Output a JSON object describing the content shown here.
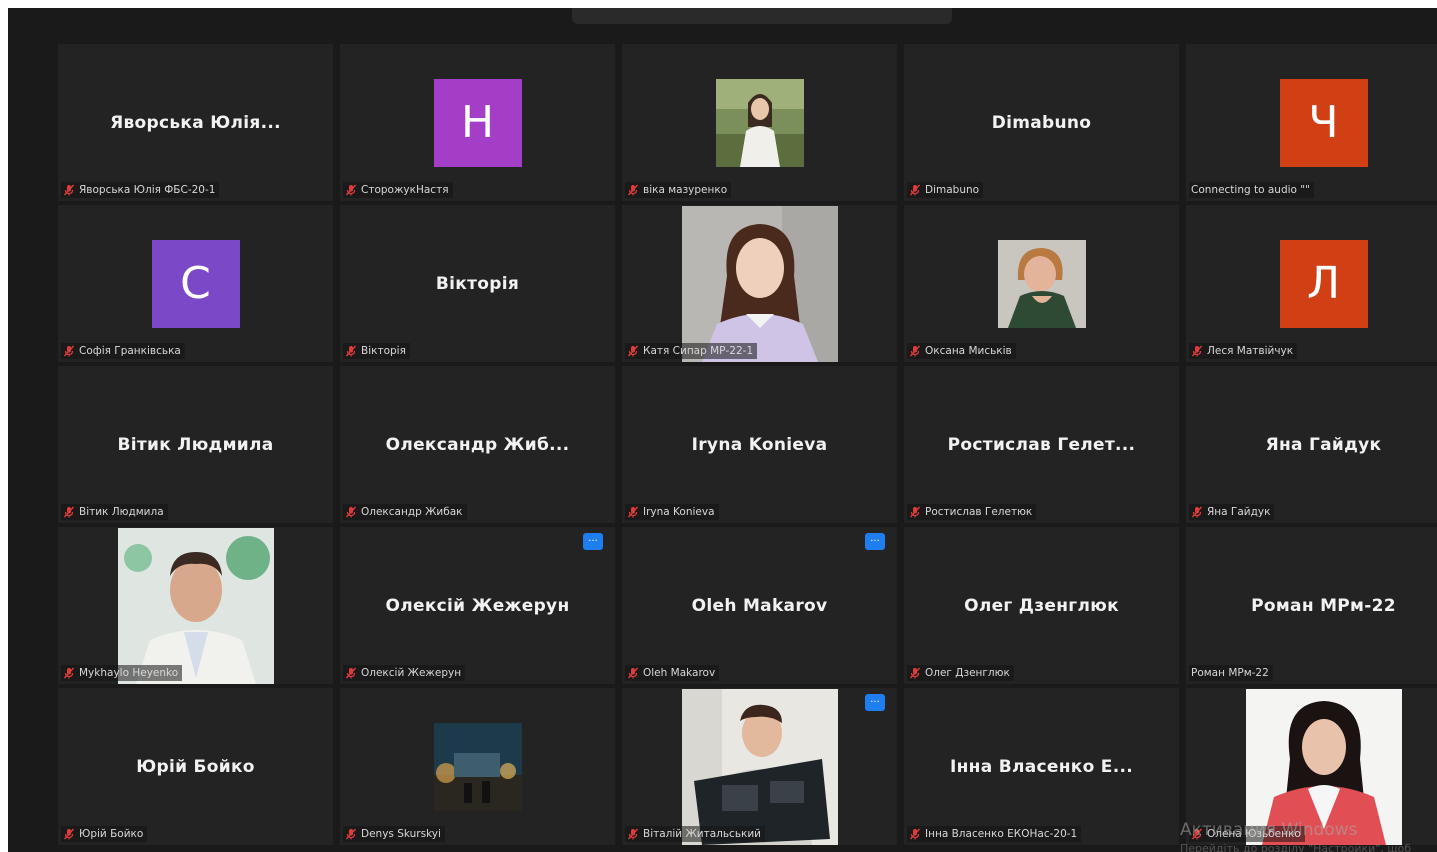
{
  "colors": {
    "background": "#1a1a1a",
    "tile": "#232323",
    "mic_muted": "#e03b3b",
    "more_button": "#1e7ef0"
  },
  "tiles": [
    {
      "display": "Яворська Юлія...",
      "label": "Яворська Юлія ФБС-20-1"
    },
    {
      "avatar": "Н",
      "avatar_color": "#a43ec7",
      "label": "СторожукНастя"
    },
    {
      "photo": "woman-in-field-photo",
      "label": "віка мазуренко"
    },
    {
      "display": "Dimabuno",
      "label": "Dimabuno"
    },
    {
      "avatar": "Ч",
      "avatar_color": "#d04014",
      "label": "Connecting to audio \"\""
    },
    {
      "avatar": "С",
      "avatar_color": "#7b48c8",
      "label": "Софія Гранківська"
    },
    {
      "display": "Вікторія",
      "label": "Вікторія"
    },
    {
      "photo": "young-woman-portrait-photo",
      "label": "Катя Сипар  МР-22-1"
    },
    {
      "photo": "woman-green-dress-photo",
      "label": "Оксана Миськів"
    },
    {
      "avatar": "Л",
      "avatar_color": "#d04014",
      "label": "Леся Матвійчук"
    },
    {
      "display": "Вітик Людмила",
      "label": "Вітик Людмила"
    },
    {
      "display": "Олександр Жиб...",
      "label": "Олександр Жибак"
    },
    {
      "display": "Iryna Konieva",
      "label": "Iryna Konieva"
    },
    {
      "display": "Ростислав Гелет...",
      "label": "Ростислав Гелетюк"
    },
    {
      "display": "Яна Гайдук",
      "label": "Яна Гайдук"
    },
    {
      "photo": "man-portrait-photo",
      "label": "Mykhaylo Heyenko"
    },
    {
      "display": "Олексій Жежерун",
      "label": "Олексій Жежерун",
      "more": "..."
    },
    {
      "display": "Oleh Makarov",
      "label": "Oleh Makarov",
      "more": "..."
    },
    {
      "display": "Олег Дзенглюк",
      "label": "Олег Дзенглюк"
    },
    {
      "display": "Роман МРм-22",
      "label": "Роман МРм-22"
    },
    {
      "display": "Юрій Бойко",
      "label": "Юрій Бойко"
    },
    {
      "photo": "night-scene-photo",
      "label": "Denys Skurskyi"
    },
    {
      "photo": "man-with-book-photo",
      "label": "Віталій Житальський",
      "more": "..."
    },
    {
      "display": "Інна Власенко Е...",
      "label": "Інна Власенко ЕКОНас-20-1"
    },
    {
      "photo": "woman-red-jacket-photo",
      "label": "Олена Юзьбенко"
    }
  ],
  "watermark": {
    "line1": "Активация Windows",
    "line2": "Перейдіть до розділу \"Настройки\", щоб"
  }
}
